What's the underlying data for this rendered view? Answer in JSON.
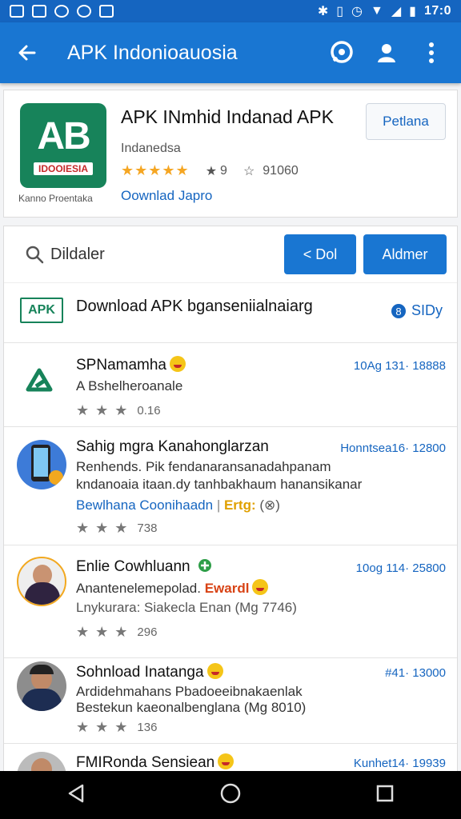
{
  "status_bar": {
    "time": "17:0"
  },
  "app_bar": {
    "title": "APK Indonioauosia"
  },
  "app_card": {
    "logo_text": "AB",
    "logo_strip": "IDOOIESIA",
    "logo_caption": "Kanno Proentaka",
    "title": "APK INmhid Indanad APK",
    "subtitle": "Indanedsa",
    "rating_a": "9",
    "rating_b": "91060",
    "link": "Oownlad Japro",
    "button": "Petlana"
  },
  "search": {
    "query": "Dildaler",
    "btn_back": "< Dol",
    "btn_right": "Aldmer"
  },
  "banner": {
    "logo": "APK",
    "text": "Download APK bganseniialnaiarg",
    "link": "SIDy"
  },
  "items": [
    {
      "title": "SPNamamha",
      "meta": "10Ag 131· 18888",
      "line1": "A Bshelheroanale",
      "rating": "0.16"
    },
    {
      "title": "Sahig mgra Kanahonglarzan",
      "meta": "Honntsea16· 12800",
      "line1": "Renhends. Pik fendanaransanadahpanam",
      "line2": "kndanoaia itaan.dy tanhbakhaum hanansikanar",
      "link": "Bewlhana Coonihaadn",
      "tag": "Ertg:",
      "rating": "738"
    },
    {
      "title": "Enlie Cowhluann",
      "meta": "10og 114· 25800",
      "line1": "Anantenelemepolad.",
      "tag": "Ewardl",
      "line2": "Lnykurara: Siakecla Enan (Mg 7746)",
      "rating": "296"
    },
    {
      "title": "Sohnload Inatanga",
      "meta": "#41· 13000",
      "line1": "Ardidehmahans Pbadoeeibnakaenlak",
      "line2": "Bestekun kaeonalbenglana (Mg 8010)",
      "rating": "136"
    },
    {
      "title": "FMIRonda Sensiean",
      "meta": "Kunhet14· 19939"
    }
  ]
}
